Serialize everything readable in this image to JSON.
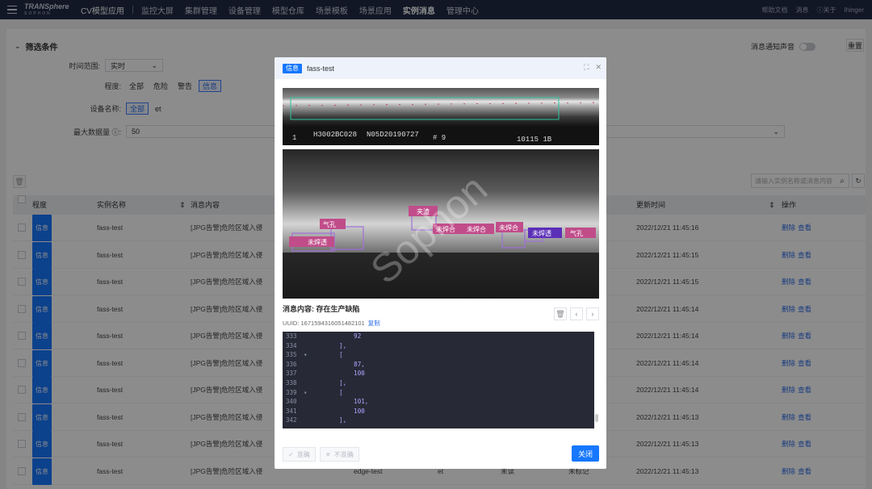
{
  "topbar": {
    "brand": "TRANSphere",
    "brand_sub": "SOPHON",
    "app_title": "CV模型应用",
    "nav": [
      "监控大屏",
      "集群管理",
      "设备管理",
      "模型仓库",
      "场景模板",
      "场景应用",
      "实例消息",
      "管理中心"
    ],
    "active_nav": "实例消息",
    "right": [
      "帮助文档",
      "消息",
      "关于",
      "Ihinger"
    ]
  },
  "filters": {
    "title": "筛选条件",
    "sound_label": "消息通知声音",
    "reset_label": "重置",
    "time_label": "时间范围:",
    "time_value": "实时",
    "level_label": "程度:",
    "levels": [
      "全部",
      "危险",
      "警告",
      "信息"
    ],
    "device_label": "设备名称:",
    "devices": [
      "全部",
      "et"
    ],
    "max_label": "最大数据量 ⓘ:",
    "max_value": "50"
  },
  "search": {
    "placeholder": "请输入实例名称或消息内容"
  },
  "table": {
    "headers": [
      "程度",
      "实例名称",
      "消息内容",
      "更新时间",
      "操作"
    ],
    "rows": [
      {
        "level": "信息",
        "name": "fass-test",
        "content": "[JPG告警]危险区域入侵",
        "time": "2022/12/21 11:45:16",
        "del": "删除",
        "view": "查看"
      },
      {
        "level": "信息",
        "name": "fass-test",
        "content": "[JPG告警]危险区域入侵",
        "time": "2022/12/21 11:45:15",
        "del": "删除",
        "view": "查看"
      },
      {
        "level": "信息",
        "name": "fass-test",
        "content": "[JPG告警]危险区域入侵",
        "time": "2022/12/21 11:45:15",
        "del": "删除",
        "view": "查看"
      },
      {
        "level": "信息",
        "name": "fass-test",
        "content": "[JPG告警]危险区域入侵",
        "time": "2022/12/21 11:45:14",
        "del": "删除",
        "view": "查看"
      },
      {
        "level": "信息",
        "name": "fass-test",
        "content": "[JPG告警]危险区域入侵",
        "time": "2022/12/21 11:45:14",
        "del": "删除",
        "view": "查看"
      },
      {
        "level": "信息",
        "name": "fass-test",
        "content": "[JPG告警]危险区域入侵",
        "time": "2022/12/21 11:45:14",
        "del": "删除",
        "view": "查看"
      },
      {
        "level": "信息",
        "name": "fass-test",
        "content": "[JPG告警]危险区域入侵",
        "time": "2022/12/21 11:45:14",
        "del": "删除",
        "view": "查看"
      },
      {
        "level": "信息",
        "name": "fass-test",
        "content": "[JPG告警]危险区域入侵",
        "time": "2022/12/21 11:45:13",
        "del": "删除",
        "view": "查看"
      },
      {
        "level": "信息",
        "name": "fass-test",
        "content": "[JPG告警]危险区域入侵",
        "time": "2022/12/21 11:45:13",
        "del": "删除",
        "view": "查看"
      },
      {
        "level": "信息",
        "name": "fass-test",
        "content": "[JPG告警]危险区域入侵",
        "time": "2022/12/21 11:45:13",
        "del": "删除",
        "view": "查看"
      }
    ],
    "last_row_extra": {
      "instance": "edge-test",
      "device": "et",
      "status": "未读",
      "mark": "未标记"
    }
  },
  "modal": {
    "badge": "信息",
    "title": "fass-test",
    "image_top_text": [
      "1",
      "H3002BC028",
      "N05D20190727",
      "# 9",
      "10115 1B"
    ],
    "labels": [
      "气孔",
      "夹渣",
      "未焊合",
      "未焊合",
      "未焊合",
      "未焊透",
      "未焊透",
      "气孔"
    ],
    "watermark": "Sophon",
    "message_label": "消息内容:",
    "message_value": "存在生产缺陷",
    "uuid_label": "UUID:",
    "uuid_value": "1671594316051482101",
    "copy_label": "复制",
    "code_lines": [
      {
        "n": "333",
        "fold": "",
        "t": "            92"
      },
      {
        "n": "334",
        "fold": "",
        "t": "        ],"
      },
      {
        "n": "335",
        "fold": "▾",
        "t": "        ["
      },
      {
        "n": "336",
        "fold": "",
        "t": "            87,"
      },
      {
        "n": "337",
        "fold": "",
        "t": "            100"
      },
      {
        "n": "338",
        "fold": "",
        "t": "        ],"
      },
      {
        "n": "339",
        "fold": "▾",
        "t": "        ["
      },
      {
        "n": "340",
        "fold": "",
        "t": "            101,"
      },
      {
        "n": "341",
        "fold": "",
        "t": "            100"
      },
      {
        "n": "342",
        "fold": "",
        "t": "        ],"
      }
    ],
    "accurate_label": "准确",
    "inaccurate_label": "不准确",
    "close_label": "关闭"
  }
}
